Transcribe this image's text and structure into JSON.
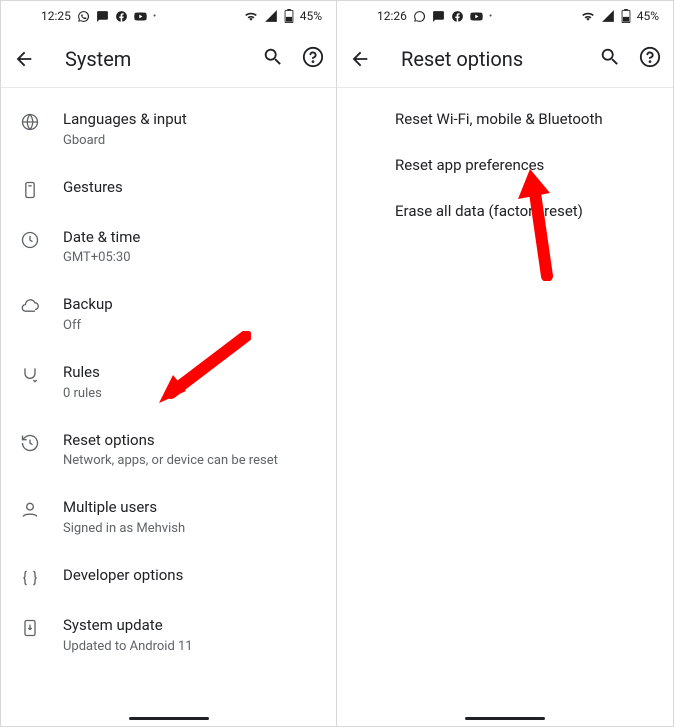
{
  "left": {
    "status": {
      "time": "12:25",
      "battery": "45%"
    },
    "header": {
      "title": "System"
    },
    "items": [
      {
        "label": "Languages & input",
        "sub": "Gboard"
      },
      {
        "label": "Gestures",
        "sub": ""
      },
      {
        "label": "Date & time",
        "sub": "GMT+05:30"
      },
      {
        "label": "Backup",
        "sub": "Off"
      },
      {
        "label": "Rules",
        "sub": "0 rules"
      },
      {
        "label": "Reset options",
        "sub": "Network, apps, or device can be reset"
      },
      {
        "label": "Multiple users",
        "sub": "Signed in as Mehvish"
      },
      {
        "label": "Developer options",
        "sub": ""
      },
      {
        "label": "System update",
        "sub": "Updated to Android 11"
      }
    ]
  },
  "right": {
    "status": {
      "time": "12:26",
      "battery": "45%"
    },
    "header": {
      "title": "Reset options"
    },
    "items": [
      {
        "label": "Reset Wi-Fi, mobile & Bluetooth"
      },
      {
        "label": "Reset app preferences"
      },
      {
        "label": "Erase all data (factory reset)"
      }
    ]
  }
}
